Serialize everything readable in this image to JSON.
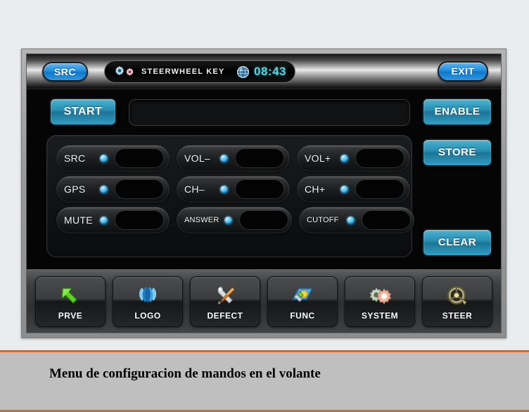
{
  "titlebar": {
    "src_label": "SRC",
    "status_text": "STEERWHEEL  KEY",
    "clock": "08:43",
    "exit_label": "EXIT",
    "gear_icon_a": "gear-icon-blue",
    "gear_icon_b": "gear-icon-pink",
    "globe_icon": "globe-icon"
  },
  "main": {
    "start_label": "START",
    "display_value": "",
    "side_buttons": [
      {
        "label": "ENABLE"
      },
      {
        "label": "STORE"
      },
      {
        "label": "CLEAR"
      }
    ],
    "key_rows": [
      [
        {
          "label": "SRC",
          "value": ""
        },
        {
          "label": "VOL–",
          "value": ""
        },
        {
          "label": "VOL+",
          "value": ""
        }
      ],
      [
        {
          "label": "GPS",
          "value": ""
        },
        {
          "label": "CH–",
          "value": ""
        },
        {
          "label": "CH+",
          "value": ""
        }
      ],
      [
        {
          "label": "MUTE",
          "value": ""
        },
        {
          "label": "ANSWER",
          "value": ""
        },
        {
          "label": "CUTOFF",
          "value": ""
        }
      ]
    ]
  },
  "navbar": {
    "items": [
      {
        "label": "PRVE",
        "icon": "green-arrow-icon"
      },
      {
        "label": "LOGO",
        "icon": "blue-petals-icon"
      },
      {
        "label": "DEFECT",
        "icon": "wrench-screwdriver-icon"
      },
      {
        "label": "FUNC",
        "icon": "blue-panel-tools-icon"
      },
      {
        "label": "SYSTEM",
        "icon": "gears-icon"
      },
      {
        "label": "STEER",
        "icon": "steering-wheel-icon"
      }
    ]
  },
  "caption": {
    "text": "Menu de configuracion de mandos en el volante"
  },
  "colors": {
    "accent_blue": "#1f8fe0",
    "button_teal": "#2a8fb4",
    "led_blue": "#66c9f2",
    "clock_cyan": "#4fd8e4",
    "caption_rule": "#c2713d",
    "page_bg": "#e9edef"
  }
}
